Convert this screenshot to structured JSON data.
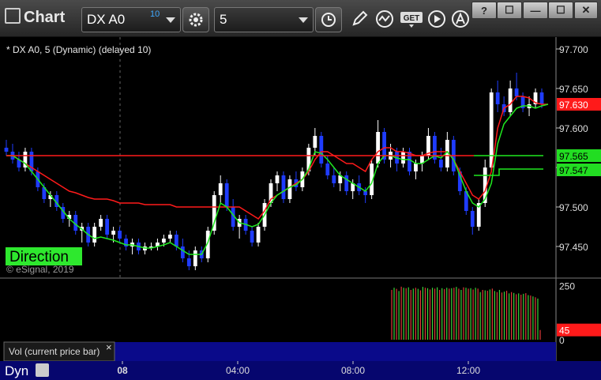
{
  "window": {
    "title": "Chart",
    "symbol": "DX A0",
    "symbol_delay": "10",
    "interval": "5",
    "help_label": "?",
    "restore_label": "☐",
    "minimize_label": "—",
    "maximize_label": "☐",
    "close_label": "✕",
    "get_label": "GET"
  },
  "chart": {
    "header_label": "* DX A0, 5 (Dynamic) (delayed 10)",
    "copyright": "© eSignal, 2019",
    "direction_label": "Direction",
    "volume_label": "Vol (current price bar)",
    "volume_close_label": "×",
    "status_label": "Dyn",
    "colors": {
      "background": "#000000",
      "up_candle": "#ffffff",
      "down_candle": "#1f3cff",
      "red_line": "#ff1a1a",
      "green_line": "#1fe81f",
      "axis_text": "#dddddd",
      "grid": "#555555",
      "bottom_bar": "#0a0a8a",
      "direction_bg": "#2ee82e"
    }
  },
  "chart_data": [
    {
      "type": "candlestick",
      "series": [
        {
          "name": "DX A0, 5 (Dynamic)",
          "values": [
            [
              97.575,
              97.585,
              97.565,
              97.57
            ],
            [
              97.57,
              97.58,
              97.555,
              97.56
            ],
            [
              97.56,
              97.57,
              97.545,
              97.55
            ],
            [
              97.55,
              97.575,
              97.545,
              97.57
            ],
            [
              97.57,
              97.575,
              97.54,
              97.545
            ],
            [
              97.545,
              97.55,
              97.52,
              97.525
            ],
            [
              97.525,
              97.53,
              97.505,
              97.51
            ],
            [
              97.51,
              97.52,
              97.5,
              97.515
            ],
            [
              97.515,
              97.52,
              97.495,
              97.5
            ],
            [
              97.5,
              97.505,
              97.48,
              97.485
            ],
            [
              97.485,
              97.495,
              97.475,
              97.49
            ],
            [
              97.49,
              97.495,
              97.465,
              97.47
            ],
            [
              97.47,
              97.48,
              97.455,
              97.475
            ],
            [
              97.475,
              97.48,
              97.45,
              97.455
            ],
            [
              97.455,
              97.48,
              97.45,
              97.475
            ],
            [
              97.475,
              97.49,
              97.47,
              97.485
            ],
            [
              97.485,
              97.49,
              97.46,
              97.465
            ],
            [
              97.465,
              97.475,
              97.455,
              97.47
            ],
            [
              97.47,
              97.475,
              97.455,
              97.46
            ],
            [
              97.46,
              97.465,
              97.445,
              97.45
            ],
            [
              97.45,
              97.46,
              97.44,
              97.455
            ],
            [
              97.455,
              97.46,
              97.44,
              97.445
            ],
            [
              97.445,
              97.455,
              97.44,
              97.45
            ],
            [
              97.45,
              97.455,
              97.445,
              97.45
            ],
            [
              97.45,
              97.46,
              97.445,
              97.455
            ],
            [
              97.455,
              97.465,
              97.45,
              97.46
            ],
            [
              97.46,
              97.47,
              97.455,
              97.465
            ],
            [
              97.465,
              97.47,
              97.445,
              97.45
            ],
            [
              97.45,
              97.46,
              97.43,
              97.435
            ],
            [
              97.435,
              97.445,
              97.42,
              97.425
            ],
            [
              97.425,
              97.45,
              97.42,
              97.445
            ],
            [
              97.445,
              97.45,
              97.43,
              97.435
            ],
            [
              97.435,
              97.475,
              97.43,
              97.47
            ],
            [
              97.47,
              97.52,
              97.465,
              97.515
            ],
            [
              97.515,
              97.54,
              97.505,
              97.53
            ],
            [
              97.53,
              97.535,
              97.495,
              97.5
            ],
            [
              97.5,
              97.51,
              97.47,
              97.475
            ],
            [
              97.475,
              97.49,
              97.46,
              97.485
            ],
            [
              97.485,
              97.49,
              97.465,
              97.47
            ],
            [
              97.47,
              97.475,
              97.45,
              97.455
            ],
            [
              97.455,
              97.48,
              97.45,
              97.475
            ],
            [
              97.475,
              97.51,
              97.47,
              97.505
            ],
            [
              97.505,
              97.535,
              97.5,
              97.53
            ],
            [
              97.53,
              97.545,
              97.52,
              97.54
            ],
            [
              97.54,
              97.545,
              97.505,
              97.51
            ],
            [
              97.51,
              97.54,
              97.505,
              97.535
            ],
            [
              97.535,
              97.545,
              97.52,
              97.525
            ],
            [
              97.525,
              97.55,
              97.52,
              97.545
            ],
            [
              97.545,
              97.58,
              97.54,
              97.575
            ],
            [
              97.575,
              97.6,
              97.565,
              97.59
            ],
            [
              97.59,
              97.595,
              97.55,
              97.555
            ],
            [
              97.555,
              97.565,
              97.535,
              97.54
            ],
            [
              97.54,
              97.55,
              97.525,
              97.53
            ],
            [
              97.53,
              97.545,
              97.52,
              97.54
            ],
            [
              97.54,
              97.545,
              97.515,
              97.52
            ],
            [
              97.52,
              97.535,
              97.51,
              97.53
            ],
            [
              97.53,
              97.54,
              97.515,
              97.52
            ],
            [
              97.52,
              97.525,
              97.505,
              97.515
            ],
            [
              97.515,
              97.56,
              97.51,
              97.555
            ],
            [
              97.555,
              97.61,
              97.55,
              97.595
            ],
            [
              97.595,
              97.6,
              97.555,
              97.56
            ],
            [
              97.56,
              97.58,
              97.55,
              97.57
            ],
            [
              97.57,
              97.575,
              97.545,
              97.555
            ],
            [
              97.555,
              97.575,
              97.55,
              97.57
            ],
            [
              97.57,
              97.575,
              97.54,
              97.545
            ],
            [
              97.545,
              97.56,
              97.535,
              97.555
            ],
            [
              97.555,
              97.57,
              97.545,
              97.565
            ],
            [
              97.565,
              97.6,
              97.56,
              97.59
            ],
            [
              97.59,
              97.595,
              97.555,
              97.56
            ],
            [
              97.56,
              97.575,
              97.545,
              97.55
            ],
            [
              97.55,
              97.595,
              97.545,
              97.585
            ],
            [
              97.585,
              97.59,
              97.54,
              97.545
            ],
            [
              97.545,
              97.55,
              97.515,
              97.52
            ],
            [
              97.52,
              97.525,
              97.49,
              97.495
            ],
            [
              97.495,
              97.5,
              97.465,
              97.475
            ],
            [
              97.475,
              97.51,
              97.47,
              97.505
            ],
            [
              97.505,
              97.56,
              97.5,
              97.55
            ],
            [
              97.55,
              97.65,
              97.545,
              97.645
            ],
            [
              97.645,
              97.66,
              97.62,
              97.63
            ],
            [
              97.63,
              97.64,
              97.615,
              97.62
            ],
            [
              97.62,
              97.66,
              97.615,
              97.65
            ],
            [
              97.65,
              97.67,
              97.635,
              97.64
            ],
            [
              97.64,
              97.645,
              97.62,
              97.625
            ],
            [
              97.625,
              97.64,
              97.615,
              97.63
            ],
            [
              97.63,
              97.65,
              97.625,
              97.645
            ],
            [
              97.645,
              97.65,
              97.625,
              97.63
            ]
          ]
        },
        {
          "name": "red line",
          "values": [
            97.565,
            97.565,
            97.56,
            97.555,
            97.55,
            97.545,
            97.54,
            97.535,
            97.53,
            97.525,
            97.52,
            97.518,
            97.515,
            97.512,
            97.51,
            97.51,
            97.51,
            97.508,
            97.505,
            97.505,
            97.505,
            97.505,
            97.503,
            97.503,
            97.503,
            97.503,
            97.503,
            97.5,
            97.5,
            97.5,
            97.5,
            97.5,
            97.5,
            97.5,
            97.5,
            97.5,
            97.5,
            97.5,
            97.495,
            97.49,
            97.485,
            97.495,
            97.51,
            97.515,
            97.52,
            97.525,
            97.53,
            97.535,
            97.545,
            97.56,
            97.57,
            97.57,
            97.565,
            97.56,
            97.555,
            97.555,
            97.55,
            97.545,
            97.56,
            97.57,
            97.575,
            97.575,
            97.57,
            97.57,
            97.568,
            97.565,
            97.565,
            97.568,
            97.57,
            97.57,
            97.57,
            97.56,
            97.545,
            97.53,
            97.515,
            97.51,
            97.52,
            97.545,
            97.6,
            97.625,
            97.63,
            97.64,
            97.64,
            97.638,
            97.632,
            97.63,
            97.63
          ]
        },
        {
          "name": "green line",
          "values": [
            97.565,
            97.565,
            97.56,
            97.555,
            97.545,
            97.535,
            97.525,
            97.515,
            97.505,
            97.495,
            97.485,
            97.478,
            97.472,
            97.465,
            97.46,
            97.462,
            97.46,
            97.458,
            97.455,
            97.452,
            97.452,
            97.45,
            97.448,
            97.448,
            97.45,
            97.452,
            97.455,
            97.45,
            97.445,
            97.44,
            97.44,
            97.44,
            97.455,
            97.48,
            97.505,
            97.5,
            97.49,
            97.48,
            97.478,
            97.475,
            97.478,
            97.49,
            97.505,
            97.515,
            97.52,
            97.525,
            97.528,
            97.535,
            97.548,
            97.57,
            97.568,
            97.56,
            97.55,
            97.54,
            97.535,
            97.53,
            97.525,
            97.52,
            97.53,
            97.555,
            97.565,
            97.565,
            97.562,
            97.56,
            97.56,
            97.555,
            97.555,
            97.56,
            97.565,
            97.562,
            97.57,
            97.56,
            97.54,
            97.52,
            97.505,
            97.5,
            97.51,
            97.53,
            97.58,
            97.605,
            97.615,
            97.625,
            97.628,
            97.628,
            97.625,
            97.628,
            97.63
          ]
        },
        {
          "name": "red level",
          "values": [
            97.565,
            97.565
          ]
        },
        {
          "name": "green level",
          "values": [
            97.548,
            97.548
          ]
        }
      ],
      "x_labels": [
        "08",
        "04:00",
        "08:00",
        "12:00"
      ],
      "y_ticks": [
        97.45,
        97.5,
        97.55,
        97.6,
        97.65,
        97.7
      ],
      "ylim": [
        97.41,
        97.715
      ],
      "price_labels": [
        "97.630",
        "97.565",
        "97.547"
      ],
      "grid": false,
      "legend": "none"
    },
    {
      "type": "bar",
      "series": [
        {
          "name": "Vol (current price bar)",
          "values": [
            230,
            240,
            235,
            225,
            245,
            240,
            238,
            242,
            230,
            236,
            240,
            235,
            228,
            244,
            240,
            238,
            232,
            240,
            236,
            242,
            230,
            238,
            234,
            240,
            236,
            238,
            240,
            244,
            236,
            230,
            242,
            240,
            236,
            238,
            232,
            240,
            236,
            220,
            230,
            228,
            226,
            232,
            236,
            225,
            220,
            230,
            218,
            222,
            226,
            214,
            220,
            216,
            210,
            214,
            208,
            212,
            215,
            206,
            204,
            200,
            196,
            190,
            45
          ]
        }
      ],
      "y_ticks": [
        0,
        250
      ],
      "ylim": [
        0,
        270
      ],
      "current_label": "45"
    }
  ]
}
